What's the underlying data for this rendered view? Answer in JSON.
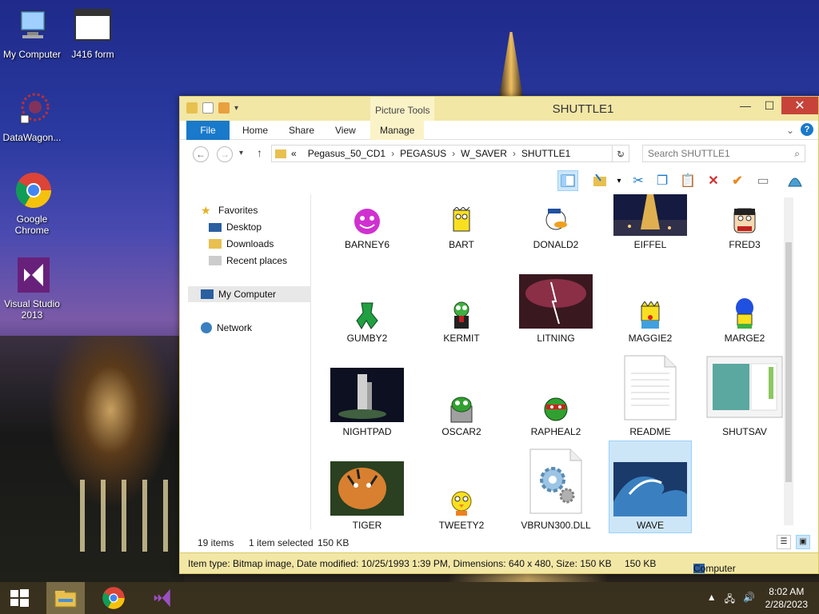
{
  "desktop": {
    "icons": [
      {
        "label": "My Computer"
      },
      {
        "label": "J416 form"
      },
      {
        "label": "DataWagon..."
      },
      {
        "label": "Google Chrome"
      },
      {
        "label": "Visual Studio 2013"
      }
    ]
  },
  "window": {
    "title": "SHUTTLE1",
    "context_tab": "Picture Tools",
    "ribbon_tabs": [
      "File",
      "Home",
      "Share",
      "View",
      "Manage"
    ],
    "address": {
      "prefix": "«",
      "crumbs": [
        "Pegasus_50_CD1",
        "PEGASUS",
        "W_SAVER",
        "SHUTTLE1"
      ]
    },
    "search_placeholder": "Search SHUTTLE1",
    "nav": {
      "favorites": "Favorites",
      "desktop": "Desktop",
      "downloads": "Downloads",
      "recent": "Recent places",
      "computer": "My Computer",
      "network": "Network"
    },
    "files": [
      {
        "name": "BARNEY6"
      },
      {
        "name": "BART"
      },
      {
        "name": "DONALD2"
      },
      {
        "name": "EIFFEL"
      },
      {
        "name": "FRED3"
      },
      {
        "name": "GUMBY2"
      },
      {
        "name": "KERMIT"
      },
      {
        "name": "LITNING"
      },
      {
        "name": "MAGGIE2"
      },
      {
        "name": "MARGE2"
      },
      {
        "name": "NIGHTPAD"
      },
      {
        "name": "OSCAR2"
      },
      {
        "name": "RAPHEAL2"
      },
      {
        "name": "README"
      },
      {
        "name": "SHUTSAV"
      },
      {
        "name": "TIGER"
      },
      {
        "name": "TWEETY2"
      },
      {
        "name": "VBRUN300.DLL"
      },
      {
        "name": "WAVE"
      }
    ],
    "status": {
      "count": "19 items",
      "selected": "1 item selected",
      "size": "150 KB"
    },
    "details": {
      "info": "Item type: Bitmap image, Date modified: 10/25/1993 1:39 PM, Dimensions: 640 x 480, Size: 150 KB",
      "size": "150 KB",
      "location": "Computer"
    }
  },
  "taskbar": {
    "time": "8:02 AM",
    "date": "2/28/2023"
  }
}
